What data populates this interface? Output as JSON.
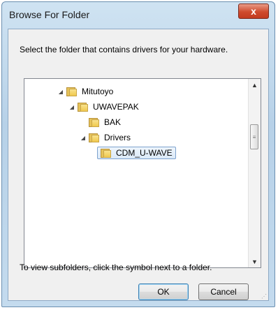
{
  "window": {
    "title": "Browse For Folder",
    "close_glyph": "x"
  },
  "prompt": "Select the folder that contains drivers for your hardware.",
  "tree": {
    "nodes": [
      {
        "label": "Mitutoyo",
        "expanded": true,
        "icon": "folder-icon"
      },
      {
        "label": "UWAVEPAK",
        "expanded": true,
        "icon": "folder-icon"
      },
      {
        "label": "BAK",
        "expanded": false,
        "icon": "folder-icon"
      },
      {
        "label": "Drivers",
        "expanded": true,
        "icon": "folder-icon"
      },
      {
        "label": "CDM_U-WAVE",
        "expanded": false,
        "selected": true,
        "icon": "folder-icon"
      }
    ],
    "scroll_up": "▲",
    "scroll_down": "▼",
    "thumb_grip": "≡"
  },
  "hint": "To view subfolders, click the symbol next to a folder.",
  "buttons": {
    "ok": "OK",
    "cancel": "Cancel"
  },
  "colors": {
    "title_bar": "#cfe3f2",
    "close": "#cf4b2e",
    "selection": "#dbe9f7"
  }
}
